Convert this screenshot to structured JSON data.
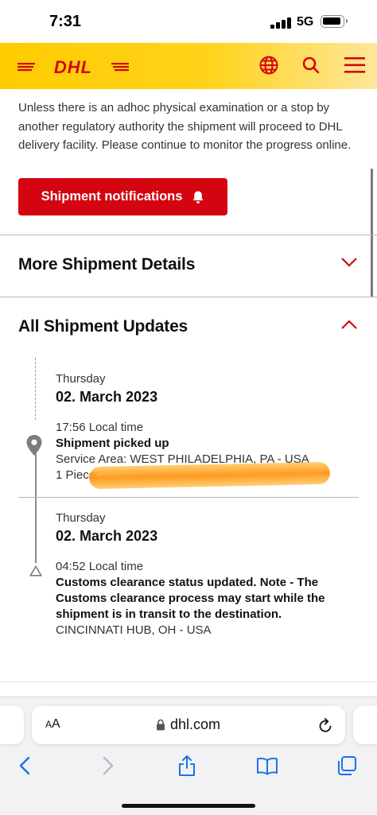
{
  "status_bar": {
    "time": "7:31",
    "network": "5G"
  },
  "header": {
    "logo_text": "DHL",
    "icons": [
      "globe-icon",
      "search-icon",
      "menu-icon"
    ],
    "brand_color": "#ffcc00",
    "accent_color": "#d40511"
  },
  "intro_text": "Unless there is an adhoc physical examination or a stop by another regulatory authority the shipment will proceed to DHL delivery facility. Please continue to monitor the progress online.",
  "notifications_button": {
    "label": "Shipment notifications",
    "icon": "bell-icon"
  },
  "sections": {
    "more_details": {
      "title": "More Shipment Details",
      "state": "collapsed"
    },
    "all_updates": {
      "title": "All Shipment Updates",
      "state": "expanded"
    }
  },
  "updates": [
    {
      "day": "Thursday",
      "date": "02. March 2023",
      "time": "17:56 Local time",
      "status": "Shipment picked up",
      "service_area": "Service Area: WEST PHILADELPHIA, PA - USA",
      "pieces": "1 Piece: ",
      "icon": "location-pin-icon"
    },
    {
      "day": "Thursday",
      "date": "02. March 2023",
      "time": "04:52 Local time",
      "status": "Customs clearance status updated. Note - The Customs clearance process may start while the shipment is in transit to the destination.",
      "location": "CINCINNATI HUB, OH - USA",
      "icon": "triangle-icon"
    }
  ],
  "browser": {
    "text_size_label_small": "A",
    "text_size_label_large": "A",
    "url": "dhl.com",
    "toolbar": [
      "back-icon",
      "forward-icon",
      "share-icon",
      "bookmarks-icon",
      "tabs-icon"
    ]
  }
}
